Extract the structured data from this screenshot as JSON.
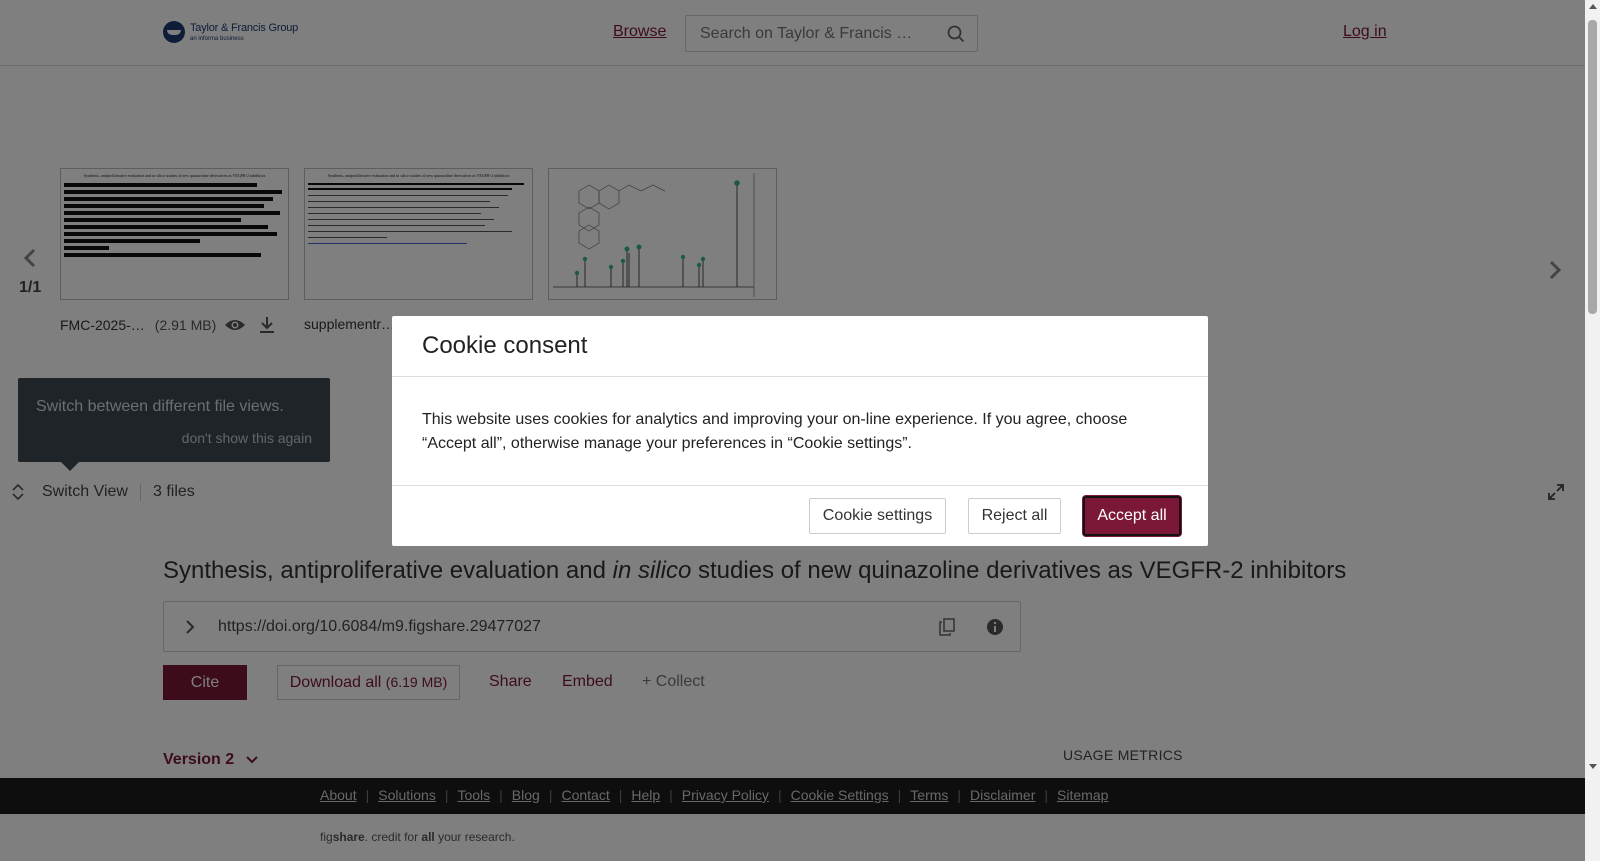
{
  "header": {
    "logo_main": "Taylor & Francis Group",
    "logo_sub": "an informa business",
    "browse_label": "Browse",
    "search_placeholder": "Search on Taylor & Francis …",
    "login_label": "Log in"
  },
  "viewer": {
    "page_counter": "1/1",
    "files": [
      {
        "name": "FMC-2025-…",
        "size": "(2.91 MB)",
        "doc_title": "Synthesis, antiproliferative evaluation and in silico studies of new quinazoline derivatives as VEGFR-2 inhibitors"
      },
      {
        "name": "supplementr…",
        "doc_title": "Synthesis, antiproliferative evaluation and in silico studies of new quinazoline derivatives as VEGFR-2 inhibitors"
      },
      {
        "name": ""
      }
    ],
    "tooltip_text": "Switch between different file views.",
    "tooltip_dismiss": "don't show this again",
    "switch_view_label": "Switch View",
    "file_count": "3 files"
  },
  "article": {
    "title_before": "Synthesis, antiproliferative evaluation and ",
    "title_italic": "in silico",
    "title_after": " studies of new quinazoline derivatives as VEGFR-2 inhibitors",
    "doi": "https://doi.org/10.6084/m9.figshare.29477027",
    "cite_label": "Cite",
    "download_label": "Download all",
    "download_size": "(6.19 MB)",
    "share_label": "Share",
    "embed_label": "Embed",
    "collect_label": "+ Collect",
    "version_label": "Version 2",
    "usage_metrics_label": "USAGE METRICS"
  },
  "footer": {
    "links": [
      "About",
      "Solutions",
      "Tools",
      "Blog",
      "Contact",
      "Help",
      "Privacy Policy",
      "Cookie Settings",
      "Terms",
      "Disclaimer",
      "Sitemap"
    ],
    "tagline_fig": "fig",
    "tagline_share": "share",
    "tagline_mid": ". credit for ",
    "tagline_all": "all",
    "tagline_end": " your research."
  },
  "cookie_modal": {
    "title": "Cookie consent",
    "body": "This website uses cookies for analytics and improving your on-line experience. If you agree, choose “Accept all”, otherwise manage your preferences in “Cookie settings”.",
    "settings_label": "Cookie settings",
    "reject_label": "Reject all",
    "accept_label": "Accept all"
  },
  "colors": {
    "brand": "#7b1837",
    "footer_bg": "#1c1c1c",
    "overlay": "rgba(0,0,0,0.5)",
    "tooltip_bg": "#3f4950"
  }
}
